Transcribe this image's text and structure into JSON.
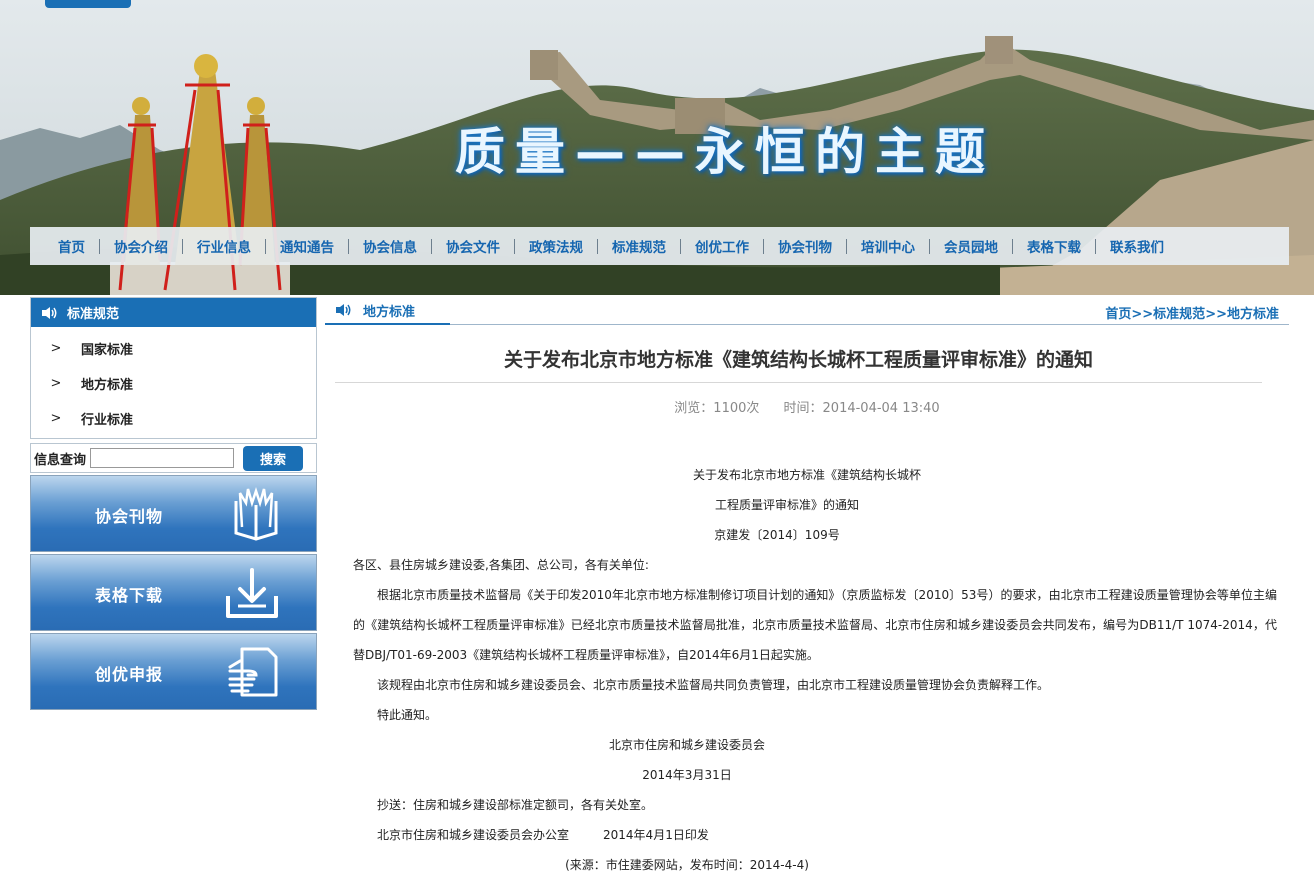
{
  "banner": {
    "slogan": "质量——永恒的主题"
  },
  "nav": {
    "items": [
      "首页",
      "协会介绍",
      "行业信息",
      "通知通告",
      "协会信息",
      "协会文件",
      "政策法规",
      "标准规范",
      "创优工作",
      "协会刊物",
      "培训中心",
      "会员园地",
      "表格下载",
      "联系我们"
    ]
  },
  "sidebar": {
    "header": "标准规范",
    "items": [
      {
        "chevron": ">",
        "label": "国家标准"
      },
      {
        "chevron": ">",
        "label": "地方标准"
      },
      {
        "chevron": ">",
        "label": "行业标准"
      }
    ],
    "search": {
      "label": "信息查询",
      "value": "",
      "placeholder": "",
      "button": "搜索"
    },
    "promos": [
      {
        "label": "协会刊物",
        "icon": "book-icon"
      },
      {
        "label": "表格下载",
        "icon": "download-icon"
      },
      {
        "label": "创优申报",
        "icon": "hand-document-icon"
      }
    ]
  },
  "main": {
    "tab": "地方标准",
    "breadcrumb": {
      "home": "首页",
      "sep1": ">>",
      "level1": "标准规范",
      "sep2": ">>",
      "level2": "地方标准"
    },
    "article": {
      "title": "关于发布北京市地方标准《建筑结构长城杯工程质量评审标准》的通知",
      "views": "浏览：1100次",
      "time": "时间：2014-04-04 13:40",
      "heading1": "关于发布北京市地方标准《建筑结构长城杯",
      "heading2": "工程质量评审标准》的通知",
      "doc_number": "京建发〔2014〕109号",
      "addressee": "各区、县住房城乡建设委,各集团、总公司，各有关单位:",
      "para1": "根据北京市质量技术监督局《关于印发2010年北京市地方标准制修订项目计划的通知》（京质监标发〔2010〕53号）的要求，由北京市工程建设质量管理协会等单位主编的《建筑结构长城杯工程质量评审标准》已经北京市质量技术监督局批准，北京市质量技术监督局、北京市住房和城乡建设委员会共同发布，编号为DB11/T 1074-2014，代替DBJ/T01-69-2003《建筑结构长城杯工程质量评审标准》，自2014年6月1日起实施。",
      "para2": "该规程由北京市住房和城乡建设委员会、北京市质量技术监督局共同负责管理，由北京市工程建设质量管理协会负责解释工作。",
      "para3": "特此通知。",
      "signer": "北京市住房和城乡建设委员会",
      "sign_date": "2014年3月31日",
      "cc": "抄送：住房和城乡建设部标准定额司，各有关处室。",
      "issuer": "北京市住房和城乡建设委员会办公室",
      "issue_date": "2014年4月1日印发",
      "source": "(来源：市住建委网站，发布时间：2014-4-4)"
    }
  },
  "colors": {
    "accent": "#1a6fb5",
    "nav_text": "#1666b0"
  }
}
